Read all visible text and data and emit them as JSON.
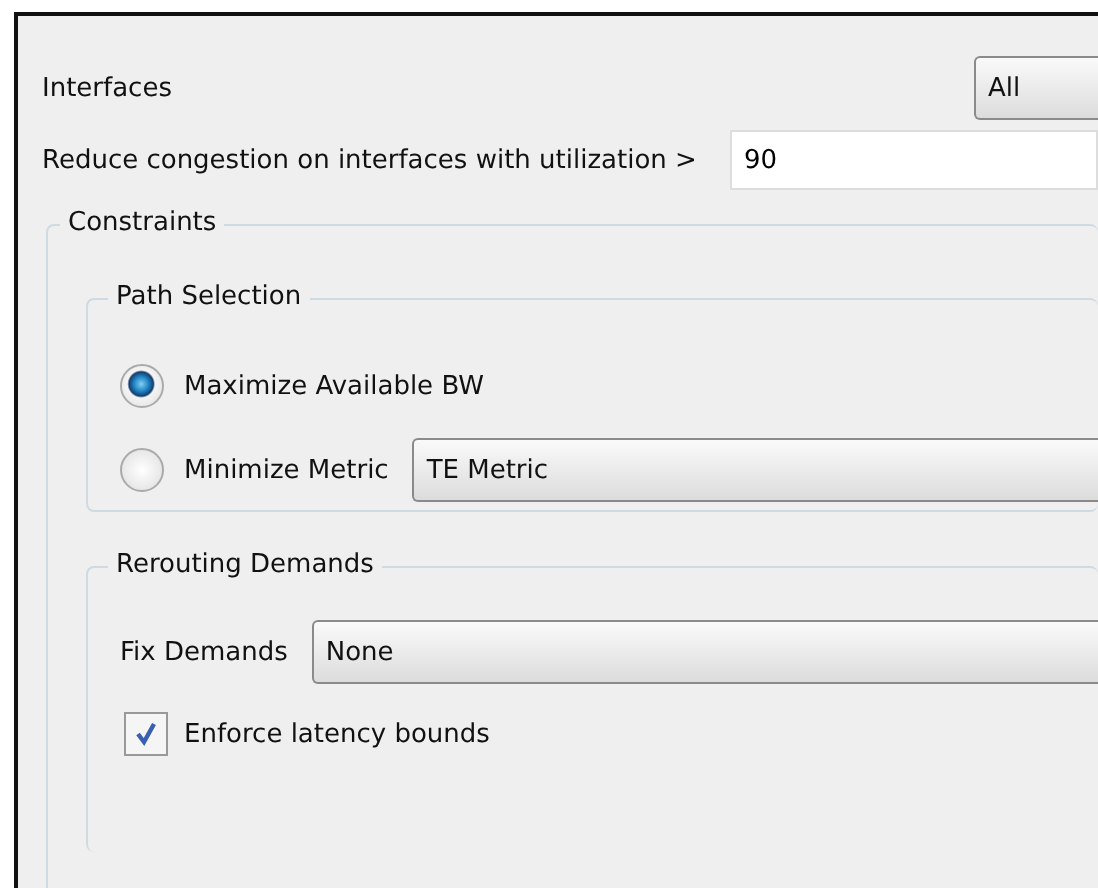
{
  "interfaces": {
    "label": "Interfaces",
    "value": "All"
  },
  "congestion": {
    "label": "Reduce congestion on interfaces with utilization >",
    "value": "90"
  },
  "constraints": {
    "title": "Constraints",
    "path_selection": {
      "title": "Path Selection",
      "options": [
        {
          "label": "Maximize Available BW",
          "selected": true
        },
        {
          "label": "Minimize Metric",
          "selected": false,
          "dropdown": "TE Metric"
        }
      ]
    },
    "rerouting_demands": {
      "title": "Rerouting Demands",
      "fix_demands": {
        "label": "Fix Demands",
        "value": "None"
      },
      "enforce_latency": {
        "label": "Enforce latency bounds",
        "checked": true
      }
    }
  }
}
